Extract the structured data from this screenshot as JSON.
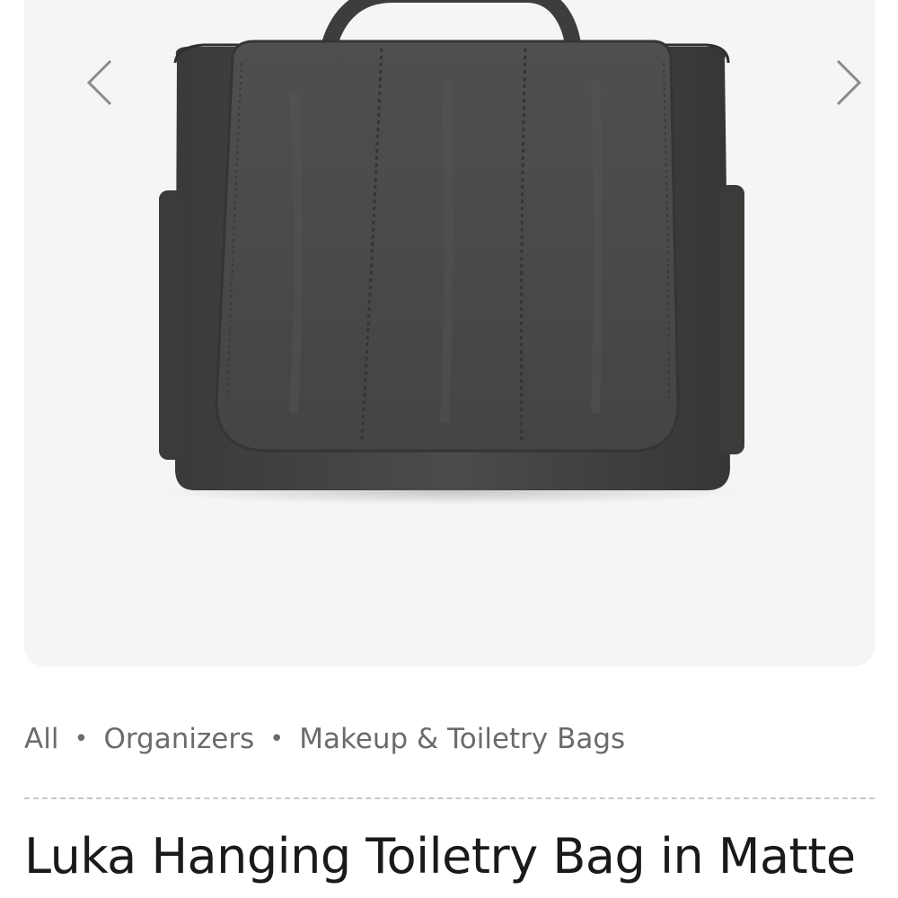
{
  "gallery": {
    "prev_label": "Previous image",
    "next_label": "Next image",
    "image_alt": "Luka Hanging Toiletry Bag in Matte",
    "bag_color": "#4a4a48",
    "background_color": "#f5f5f5"
  },
  "breadcrumb": {
    "items": [
      "All",
      "Organizers",
      "Makeup & Toiletry Bags"
    ],
    "separator": "•"
  },
  "product": {
    "title": "Luka Hanging Toiletry Bag in Matte"
  }
}
